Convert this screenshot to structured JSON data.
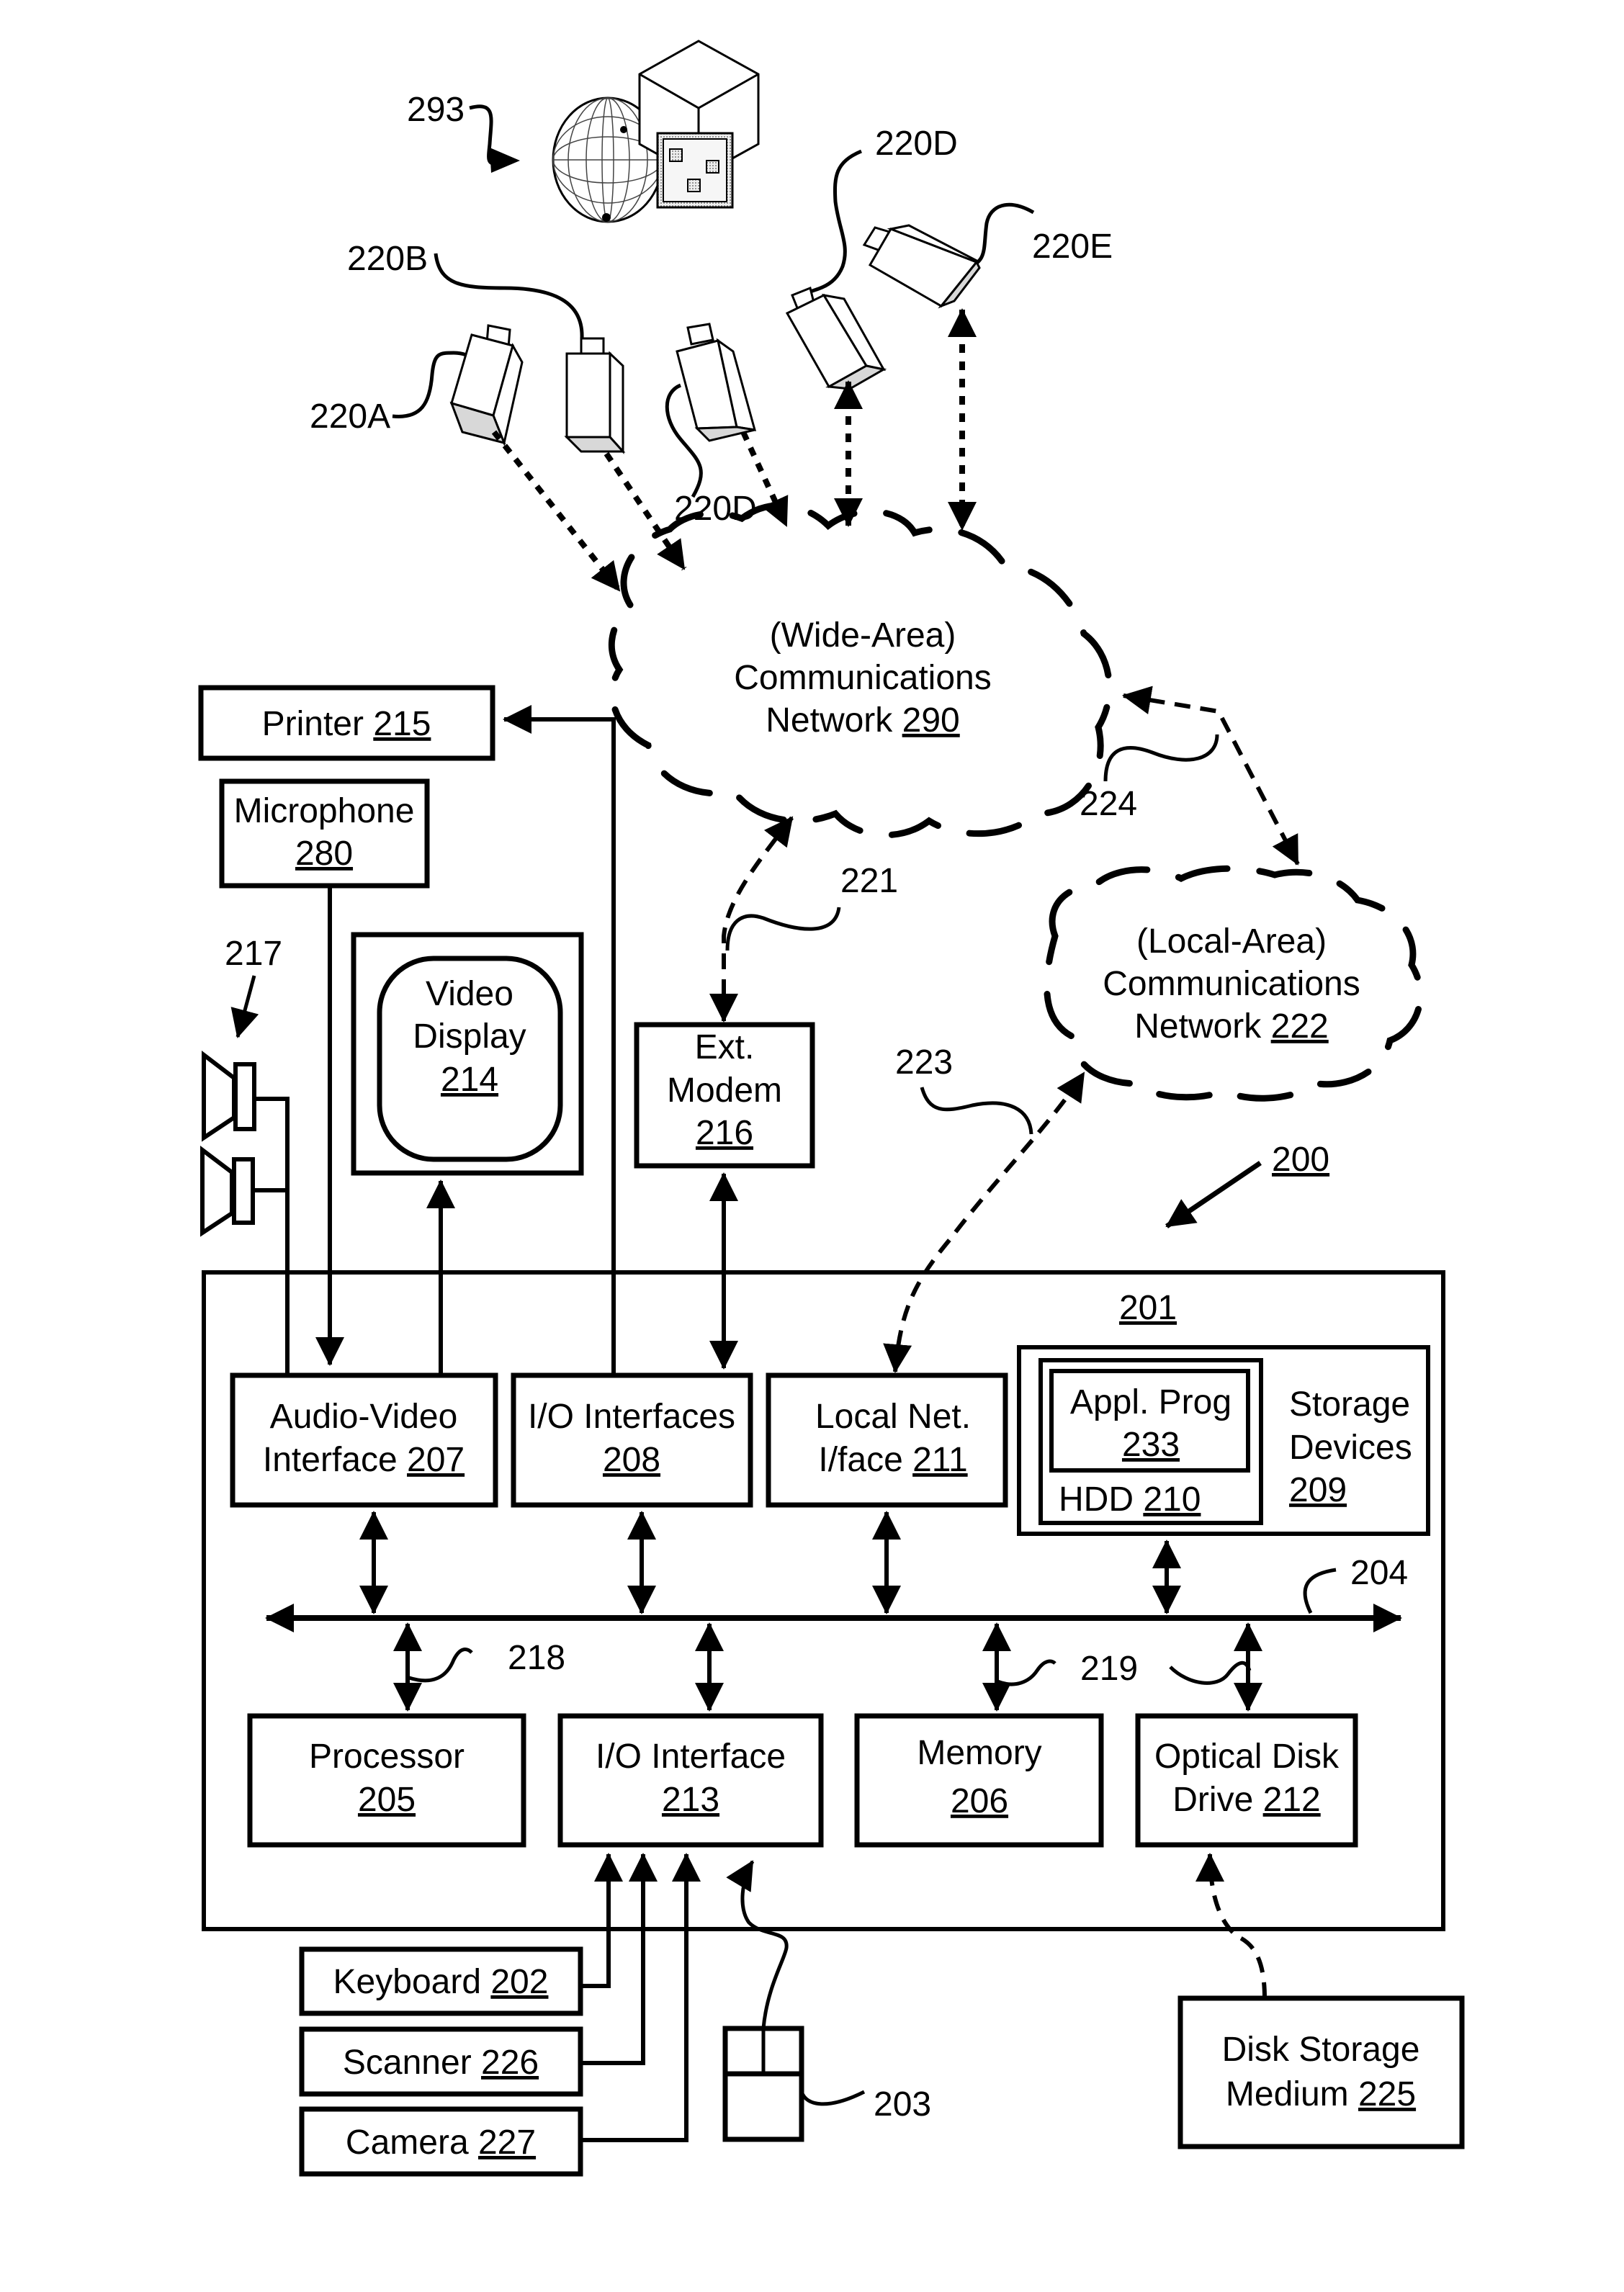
{
  "figure": {
    "system_ref": "200",
    "computer_ref": "201",
    "objects_ref": "293"
  },
  "cameras": [
    {
      "id": "220A",
      "label": "220A"
    },
    {
      "id": "220B",
      "label": "220B"
    },
    {
      "id": "220C",
      "label": "220D"
    },
    {
      "id": "220D",
      "label": "220D"
    },
    {
      "id": "220E",
      "label": "220E"
    }
  ],
  "networks": {
    "wan": {
      "line1": "(Wide-Area)",
      "line2": "Communications",
      "line3": "Network",
      "ref": "290"
    },
    "lan": {
      "line1": "(Local-Area)",
      "line2": "Communications",
      "line3": "Network",
      "ref": "222"
    }
  },
  "connections": {
    "modem_link": "221",
    "lan_link": "223",
    "wan_lan_link": "224",
    "bus_main": "204",
    "bus_left": "218",
    "bus_right": "219",
    "speakers": "217",
    "mouse": "203"
  },
  "peripherals": {
    "printer": {
      "name": "Printer",
      "ref": "215"
    },
    "microphone": {
      "name": "Microphone",
      "ref": "280"
    },
    "video_display": {
      "line1": "Video",
      "line2": "Display",
      "ref": "214"
    },
    "ext_modem": {
      "line1": "Ext.",
      "line2": "Modem",
      "ref": "216"
    },
    "keyboard": {
      "name": "Keyboard",
      "ref": "202"
    },
    "scanner": {
      "name": "Scanner",
      "ref": "226"
    },
    "camera": {
      "name": "Camera",
      "ref": "227"
    },
    "disk_storage": {
      "line1": "Disk Storage",
      "line2": "Medium",
      "ref": "225"
    }
  },
  "components": {
    "av_interface": {
      "line1": "Audio-Video",
      "line2": "Interface",
      "ref": "207"
    },
    "io_interfaces": {
      "line1": "I/O Interfaces",
      "ref": "208"
    },
    "local_net": {
      "line1": "Local Net.",
      "line2": "I/face",
      "ref": "211"
    },
    "storage_devices": {
      "line1": "Storage",
      "line2": "Devices",
      "ref": "209"
    },
    "hdd": {
      "name": "HDD",
      "ref": "210"
    },
    "appl_prog": {
      "line1": "Appl. Prog",
      "ref": "233"
    },
    "processor": {
      "line1": "Processor",
      "ref": "205"
    },
    "io_interface": {
      "line1": "I/O Interface",
      "ref": "213"
    },
    "memory": {
      "line1": "Memory",
      "ref": "206"
    },
    "optical_drive": {
      "line1": "Optical Disk",
      "line2": "Drive",
      "ref": "212"
    }
  }
}
